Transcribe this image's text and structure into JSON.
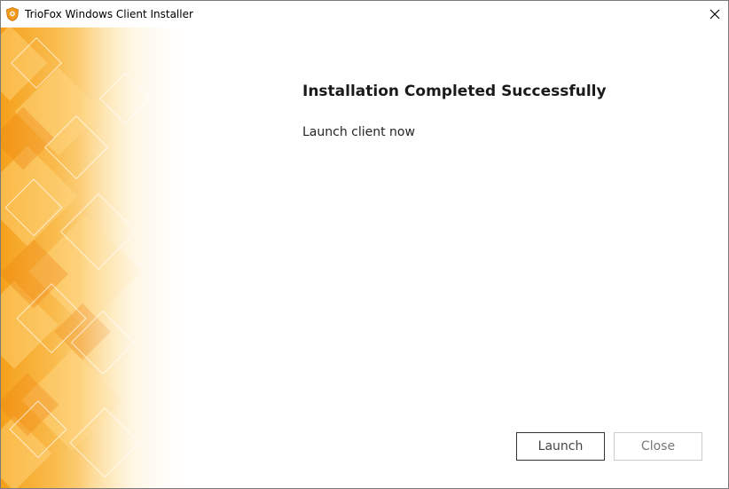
{
  "window": {
    "title": "TrioFox Windows Client Installer",
    "icon": "shield-icon",
    "close_icon": "close-icon"
  },
  "banner": {
    "pattern": "orange-diamond-pattern",
    "colors": [
      "#f5a01a",
      "#fbc04a",
      "#fde3a8",
      "#ffffff"
    ]
  },
  "content": {
    "heading": "Installation Completed Successfully",
    "subtext": "Launch client now"
  },
  "buttons": {
    "launch_label": "Launch",
    "close_label": "Close"
  }
}
